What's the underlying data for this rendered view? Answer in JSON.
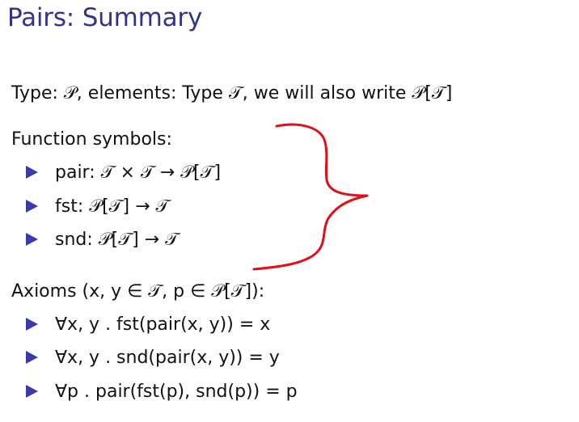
{
  "slide": {
    "title": "Pairs: Summary",
    "type_line": "Type: 𝒫, elements: Type 𝒯, we will also write 𝒫[𝒯]",
    "function_symbols_heading": "Function symbols:",
    "function_symbols": [
      "pair: 𝒯 × 𝒯 → 𝒫[𝒯]",
      "fst: 𝒫[𝒯] → 𝒯",
      "snd: 𝒫[𝒯] → 𝒯"
    ],
    "axioms_heading": "Axioms (x, y ∈ 𝒯, p ∈ 𝒫[𝒯]):",
    "axioms": [
      "∀x, y . fst(pair(x, y)) = x",
      "∀x, y . snd(pair(x, y)) = y",
      "∀p . pair(fst(p), snd(p)) = p"
    ]
  },
  "colors": {
    "title": "#33338a",
    "bullet": "#3b3ba8",
    "annotation": "#e0101a",
    "text": "#111111"
  },
  "icons": {
    "bullet": "triangle-bullet-icon",
    "annotation": "curly-brace-annotation"
  }
}
